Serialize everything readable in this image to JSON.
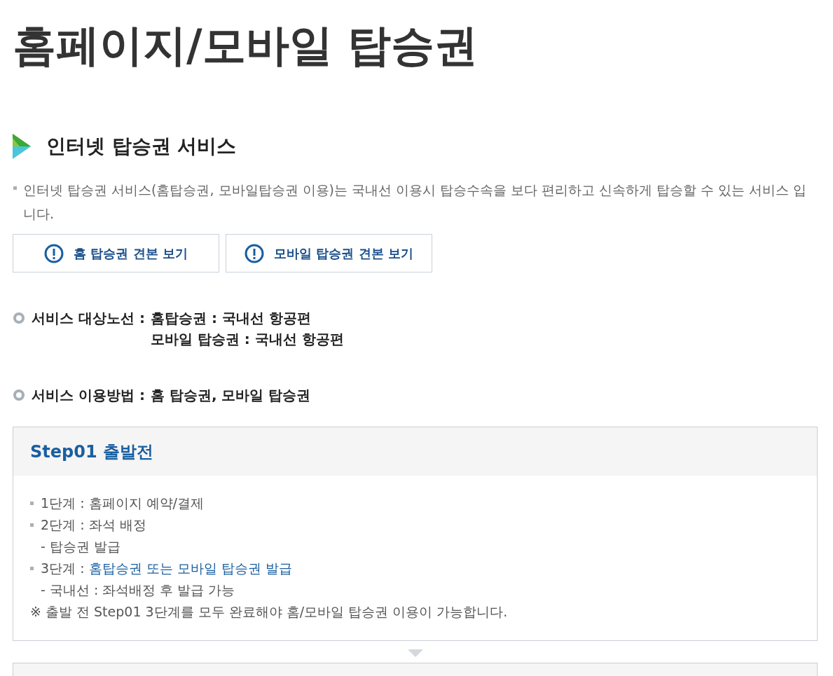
{
  "page_title": "홈페이지/모바일 탑승권",
  "section": {
    "title": "인터넷 탑승권 서비스",
    "description": "인터넷 탑승권 서비스(홈탑승권, 모바일탑승권 이용)는 국내선 이용시 탑승수속을 보다 편리하고 신속하게 탑승할 수 있는 서비스 입니다."
  },
  "buttons": [
    "홈 탑승권 견본 보기",
    "모바일 탑승권 견본 보기"
  ],
  "info_rows": [
    {
      "label": "서비스 대상노선 :",
      "values": [
        "홈탑승권 : 국내선 항공편",
        "모바일 탑승권 : 국내선 항공편"
      ]
    },
    {
      "label": "서비스 이용방법 :",
      "values": [
        "홈 탑승권, 모바일 탑승권"
      ]
    }
  ],
  "steps": [
    {
      "title": "Step01 출발전",
      "items": [
        {
          "kind": "bullet",
          "text": "1단계 : 홈페이지 예약/결제"
        },
        {
          "kind": "bullet",
          "text": "2단계 : 좌석 배정"
        },
        {
          "kind": "sub",
          "text": "- 탑승권 발급"
        },
        {
          "kind": "bullet",
          "text": "3단계 : ",
          "highlight": "홈탑승권 또는 모바일 탑승권 발급"
        },
        {
          "kind": "sub",
          "text": "- 국내선 : 좌석배정 후 발급 가능"
        },
        {
          "kind": "note",
          "text": "※ 출발 전 Step01 3단계를 모두 완료해야 홈/모바일 탑승권 이용이 가능합니다."
        }
      ]
    }
  ]
}
